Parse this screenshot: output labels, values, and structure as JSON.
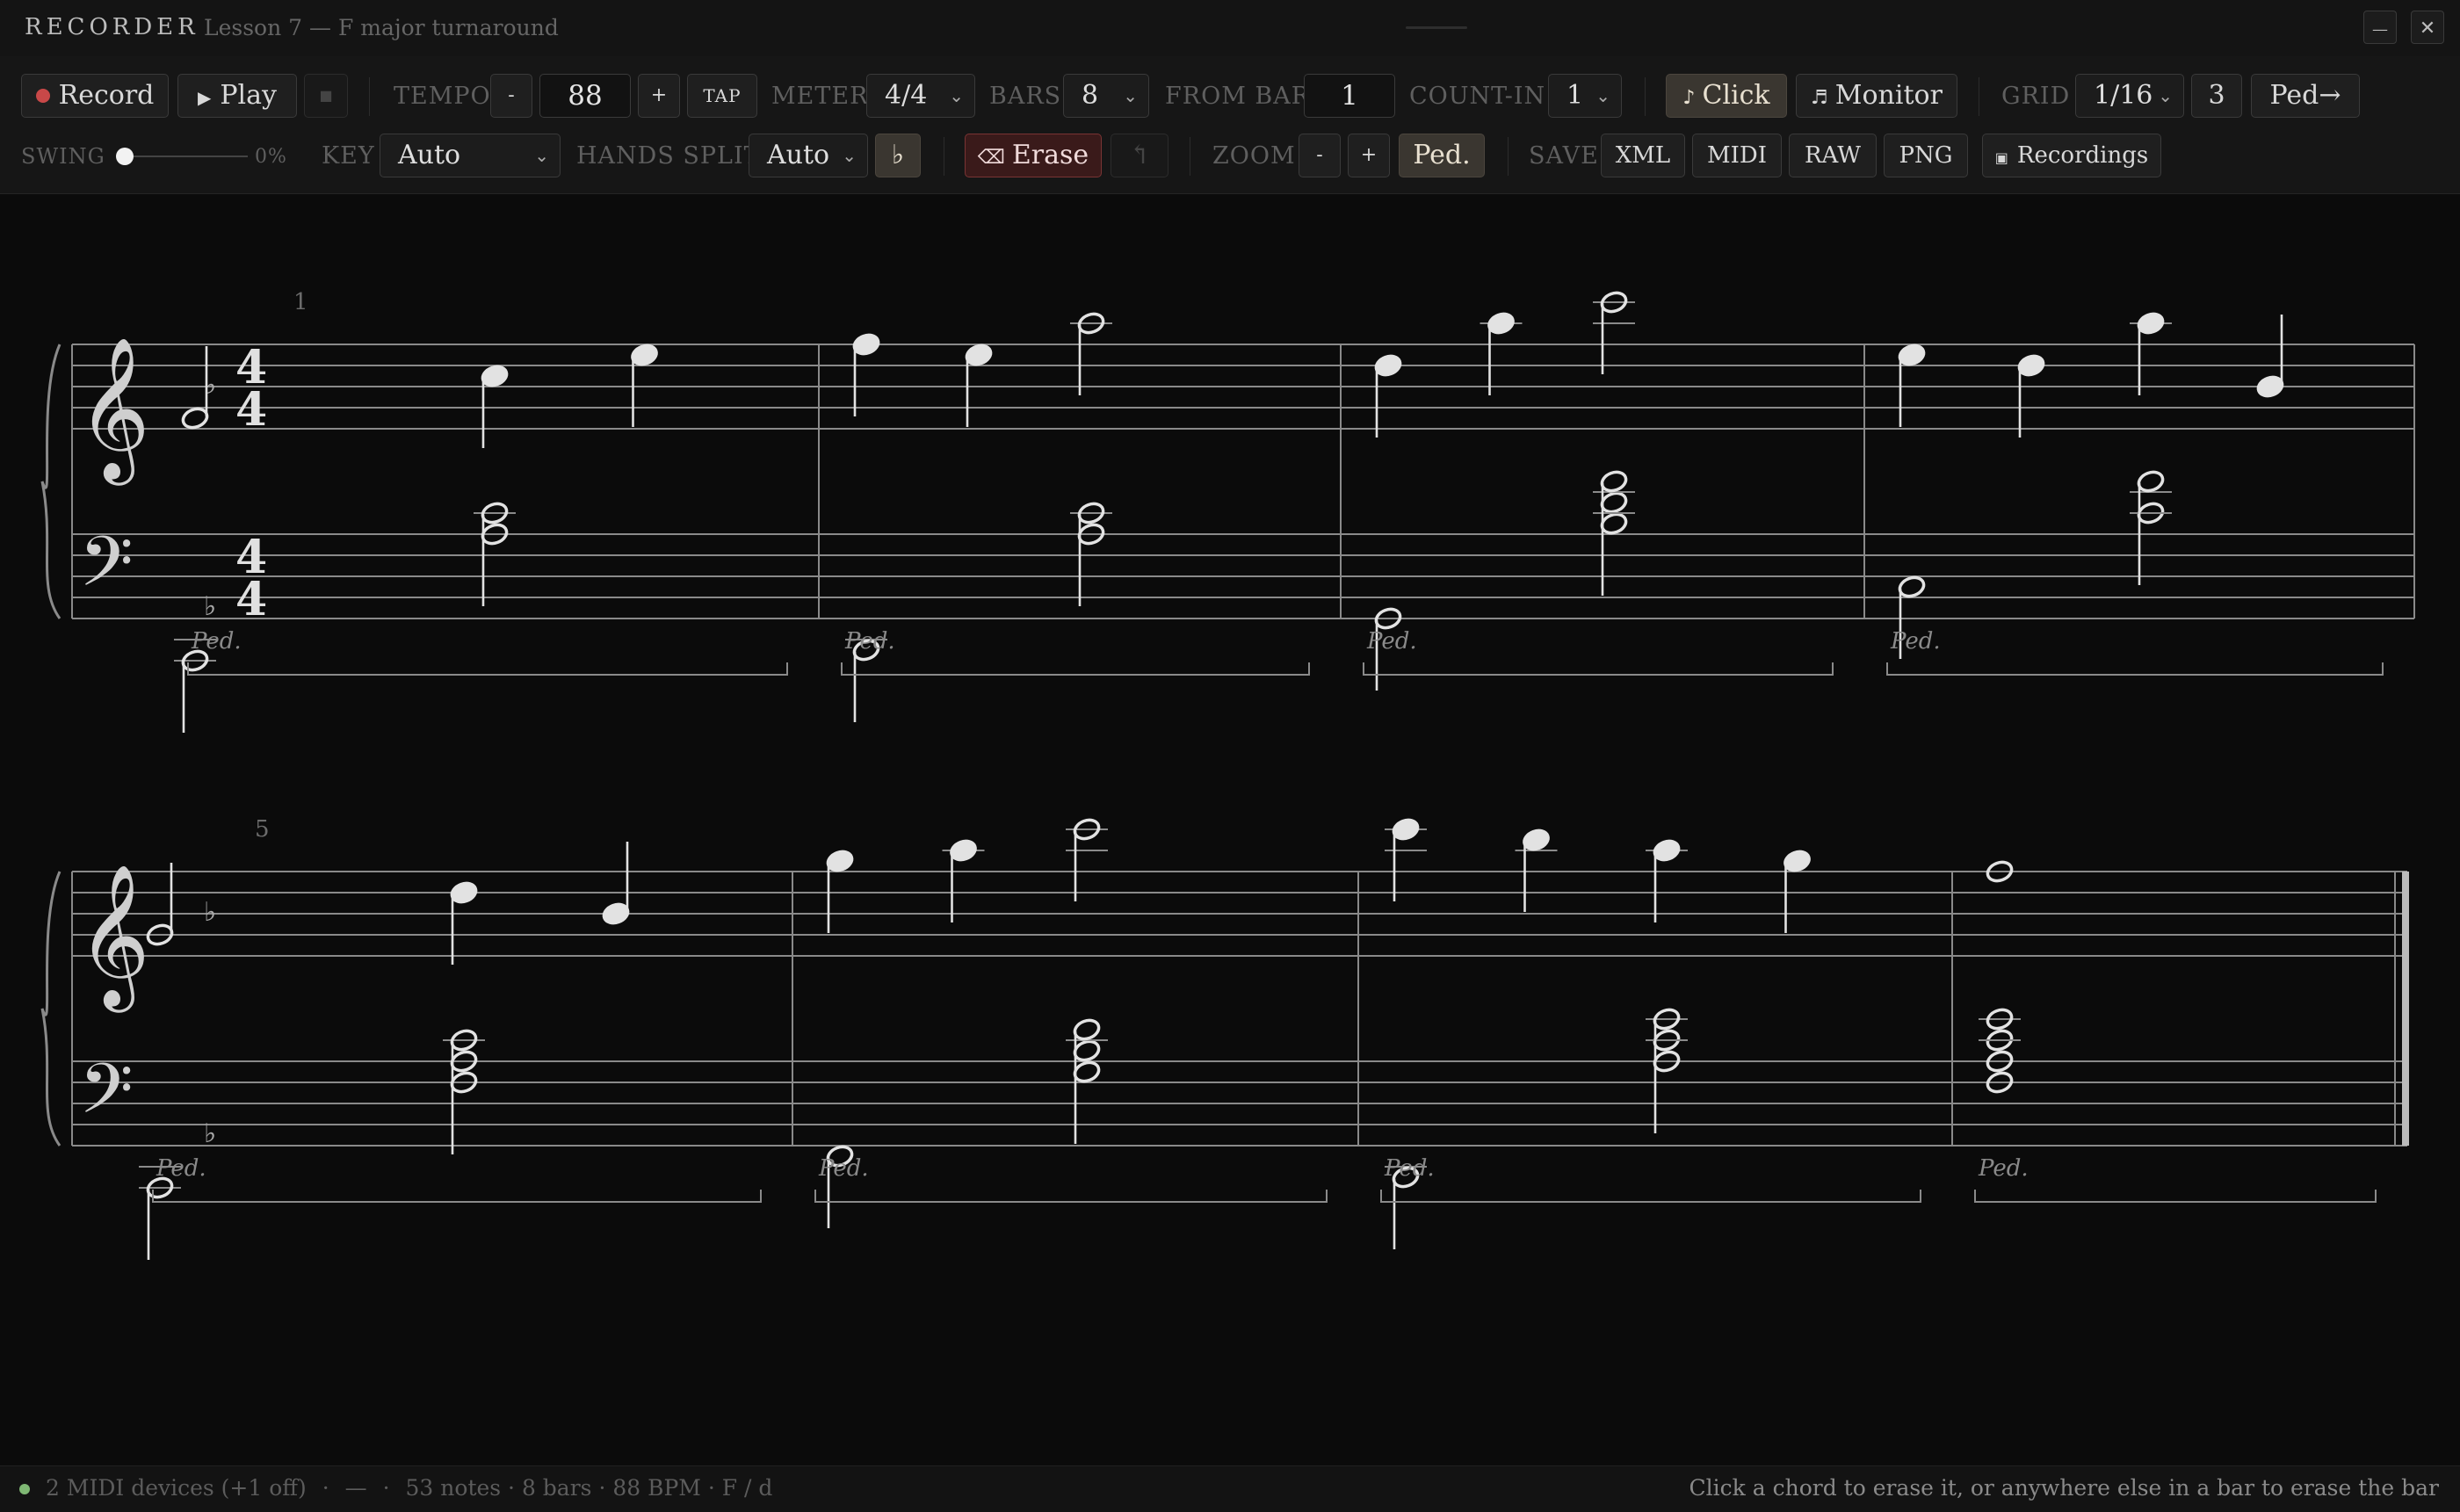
{
  "window": {
    "app_name": "RECORDER",
    "lesson_title": "Lesson 7 — F major turnaround",
    "minimize_label": "—",
    "close_label": "✕"
  },
  "toolbar": {
    "record_label": "Record",
    "play_label": "Play",
    "stop_label": "■",
    "tempo_label": "TEMPO",
    "tempo_minus": "-",
    "tempo_value": "88",
    "tempo_plus": "+",
    "tap_label": "TAP",
    "meter_label": "METER",
    "meter_value": "4/4",
    "bars_label": "BARS",
    "bars_value": "8",
    "from_bar_label": "FROM BAR",
    "from_bar_value": "1",
    "count_in_label": "COUNT-IN",
    "count_in_value": "1",
    "click_label": "Click",
    "monitor_label": "Monitor",
    "grid_label": "GRID",
    "grid_value": "1/16",
    "tuplet_value": "3",
    "ped_arrow_label": "Ped→",
    "swing_label": "SWING",
    "swing_value": "0%",
    "swing_level": 0,
    "key_label": "KEY",
    "key_value": "Auto",
    "hands_split_label": "HANDS SPLIT",
    "hands_split_value": "Auto",
    "flat_label": "♭",
    "erase_label": "Erase",
    "undo_label": "↰",
    "zoom_label": "ZOOM",
    "zoom_minus": "-",
    "zoom_plus": "+",
    "ped_label": "Ped.",
    "save_label": "SAVE",
    "xml_label": "XML",
    "midi_label": "MIDI",
    "raw_label": "RAW",
    "png_label": "PNG",
    "recordings_label": "Recordings",
    "colors": {
      "record_dot": "#c84848",
      "erase_border": "#7a3434",
      "active_bg": "#3a3630"
    }
  },
  "score": {
    "systems": [
      {
        "start_bar": "1",
        "measures": [
          {
            "treble": [
              {
                "pitch": "F4",
                "dur": "h"
              },
              {
                "pitch": "C5",
                "dur": "q"
              },
              {
                "pitch": "E5",
                "dur": "q"
              }
            ],
            "bass": [
              {
                "chord": [
                  "C2"
                ],
                "dur": "h"
              },
              {
                "chord": [
                  "A3",
                  "C4"
                ],
                "dur": "h"
              }
            ]
          },
          {
            "treble": [
              {
                "pitch": "F5",
                "dur": "q"
              },
              {
                "pitch": "E5",
                "dur": "q"
              },
              {
                "pitch": "A5",
                "dur": "h"
              }
            ],
            "bass": [
              {
                "chord": [
                  "D2"
                ],
                "dur": "h"
              },
              {
                "chord": [
                  "A3",
                  "C4"
                ],
                "dur": "h"
              }
            ]
          },
          {
            "treble": [
              {
                "pitch": "D5",
                "dur": "q"
              },
              {
                "pitch": "A5",
                "dur": "q"
              },
              {
                "pitch": "C6",
                "dur": "h"
              }
            ],
            "bass": [
              {
                "chord": [
                  "G2"
                ],
                "dur": "h"
              },
              {
                "chord": [
                  "B3",
                  "D4",
                  "F4"
                ],
                "dur": "h"
              }
            ]
          },
          {
            "treble": [
              {
                "pitch": "E5",
                "dur": "q"
              },
              {
                "pitch": "D5",
                "dur": "q"
              },
              {
                "pitch": "A5",
                "dur": "q"
              },
              {
                "pitch": "B4",
                "dur": "q"
              }
            ],
            "bass": [
              {
                "chord": [
                  "C3"
                ],
                "dur": "h"
              },
              {
                "chord": [
                  "C4",
                  "F4"
                ],
                "dur": "h"
              }
            ]
          }
        ]
      },
      {
        "start_bar": "5",
        "measures": [
          {
            "treble": [
              {
                "pitch": "G4",
                "dur": "h"
              },
              {
                "pitch": "D5",
                "dur": "q"
              },
              {
                "pitch": "B4",
                "dur": "q"
              }
            ],
            "bass": [
              {
                "chord": [
                  "C2"
                ],
                "dur": "h"
              },
              {
                "chord": [
                  "F3",
                  "A3",
                  "C4"
                ],
                "dur": "h"
              }
            ]
          },
          {
            "treble": [
              {
                "pitch": "G5",
                "dur": "q"
              },
              {
                "pitch": "A5",
                "dur": "q"
              },
              {
                "pitch": "C6",
                "dur": "h"
              }
            ],
            "bass": [
              {
                "chord": [
                  "F2"
                ],
                "dur": "h"
              },
              {
                "chord": [
                  "G3",
                  "B3",
                  "D4"
                ],
                "dur": "h"
              }
            ]
          },
          {
            "treble": [
              {
                "pitch": "C6",
                "dur": "q"
              },
              {
                "pitch": "B5",
                "dur": "q"
              },
              {
                "pitch": "A5",
                "dur": "q"
              },
              {
                "pitch": "G5",
                "dur": "q"
              }
            ],
            "bass": [
              {
                "chord": [
                  "D2"
                ],
                "dur": "h"
              },
              {
                "chord": [
                  "A3",
                  "C4",
                  "E4"
                ],
                "dur": "h"
              }
            ]
          },
          {
            "treble": [
              {
                "pitch": "F5",
                "dur": "w"
              }
            ],
            "bass": [
              {
                "chord": [
                  "F3",
                  "A3",
                  "C4",
                  "E4"
                ],
                "dur": "w"
              }
            ]
          }
        ]
      }
    ],
    "time_signature": [
      "4",
      "4"
    ],
    "key_signature": "♭",
    "pedal_text": "Ped."
  },
  "status": {
    "midi_devices": "2 MIDI devices (+1 off)",
    "sep1": "·",
    "dash": "—",
    "sep2": "·",
    "summary": "53 notes · 8 bars · 88 BPM · F / d",
    "hint": "Click a chord to erase it, or anywhere else in a bar to erase the bar"
  }
}
